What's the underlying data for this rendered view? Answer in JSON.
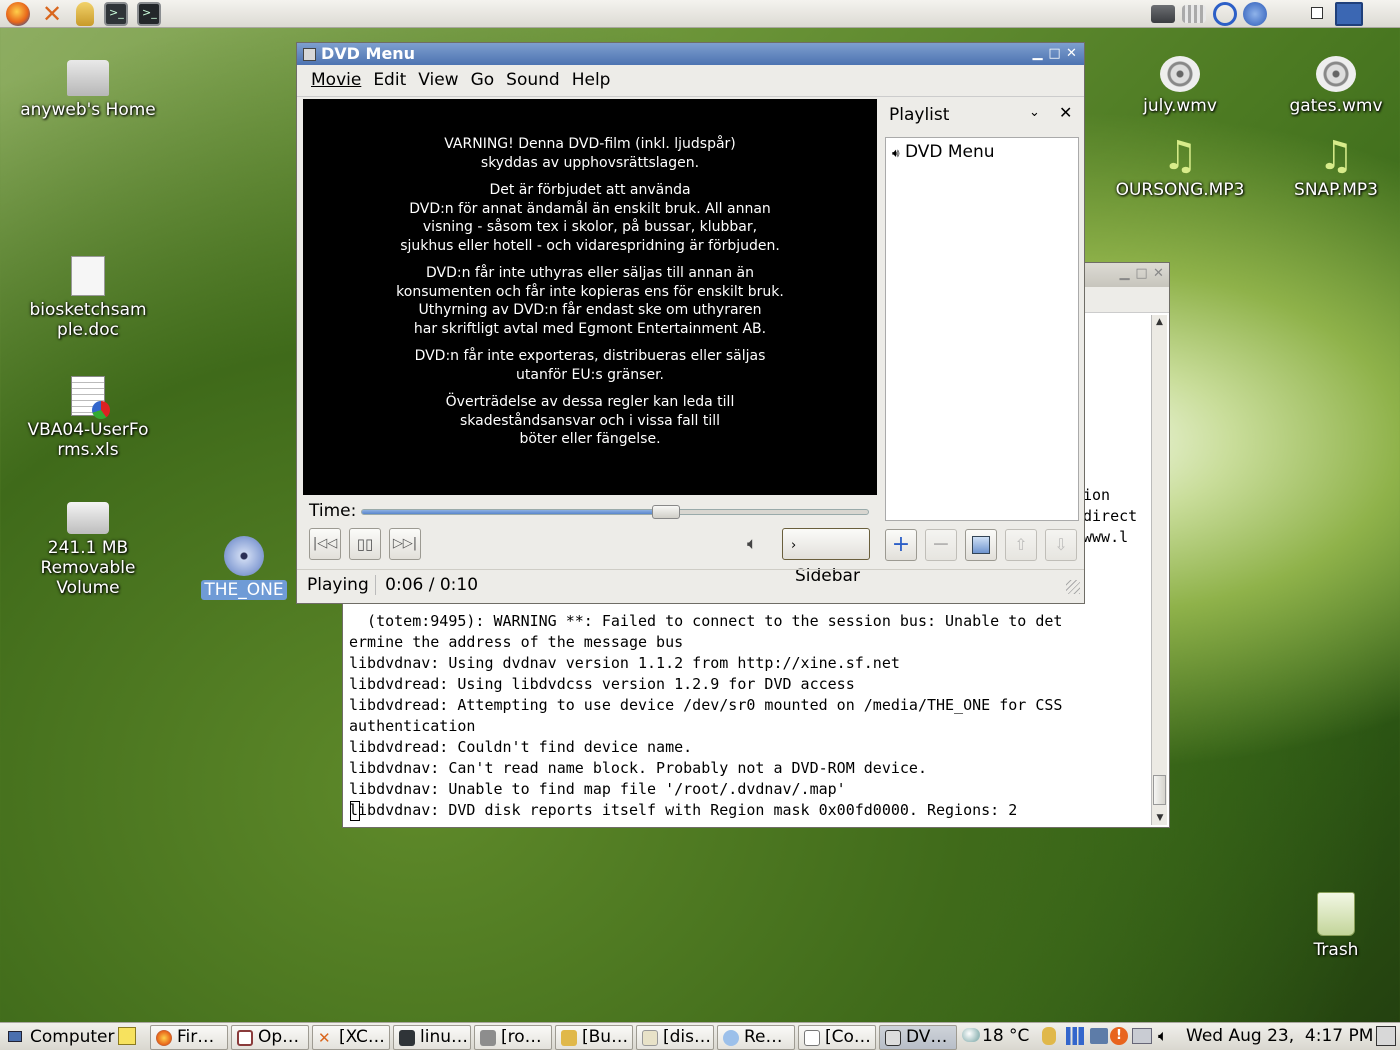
{
  "desktop": {
    "icons": [
      {
        "label": "anyweb's Home"
      },
      {
        "label": "biosketchsample.doc"
      },
      {
        "label": "VBA04-UserForms.xls"
      },
      {
        "label": "241.1 MB Removable Volume"
      },
      {
        "label": "THE_ONE"
      },
      {
        "label": "july.wmv"
      },
      {
        "label": "gates.wmv"
      },
      {
        "label": "OURSONG.MP3"
      },
      {
        "label": "SNAP.MP3"
      },
      {
        "label": "Trash"
      }
    ]
  },
  "terminal": {
    "partial_lines": [
      "ion",
      "direct",
      "www.l"
    ],
    "lines": [
      "  (totem:9495): WARNING **: Failed to connect to the session bus: Unable to det",
      "ermine the address of the message bus",
      "libdvdnav: Using dvdnav version 1.1.2 from http://xine.sf.net",
      "libdvdread: Using libdvdcss version 1.2.9 for DVD access",
      "libdvdread: Attempting to use device /dev/sr0 mounted on /media/THE_ONE for CSS",
      "authentication",
      "libdvdread: Couldn't find device name.",
      "libdvdnav: Can't read name block. Probably not a DVD-ROM device.",
      "libdvdnav: Unable to find map file '/root/.dvdnav/.map'",
      "libdvdnav: DVD disk reports itself with Region mask 0x00fd0000. Regions: 2"
    ]
  },
  "player": {
    "title": "DVD Menu",
    "menu": [
      "Movie",
      "Edit",
      "View",
      "Go",
      "Sound",
      "Help"
    ],
    "video_text": [
      "VARNING! Denna DVD-film (inkl. ljudspår)\nskyddas av upphovsrättslagen.",
      "Det är förbjudet att använda\nDVD:n för annat ändamål än enskilt bruk. All annan\nvisning - såsom tex i skolor, på bussar, klubbar,\nsjukhus eller hotell - och vidarespridning är förbjuden.",
      "DVD:n får inte uthyras eller säljas till annan än\nkonsumenten och får inte kopieras ens för enskilt bruk.\nUthyrning av DVD:n får endast ske om uthyraren\nhar skriftligt avtal med Egmont Entertainment AB.",
      "DVD:n får inte exporteras, distribueras eller säljas\nutanför EU:s gränser.",
      "Överträdelse av dessa regler kan leda till\nskadeståndsansvar och i vissa fall till\nböter eller fängelse."
    ],
    "time_label": "Time:",
    "seek_fraction": 0.6,
    "sidebar_button": "Sidebar",
    "status": "Playing",
    "time_display": "0:06 / 0:10",
    "playlist": {
      "title": "Playlist",
      "items": [
        "DVD Menu"
      ]
    }
  },
  "taskbar": {
    "menu": "Computer",
    "tasks": [
      "Fir…",
      "Op…",
      "[XC…",
      "linu…",
      "[ro…",
      "[Bu…",
      "[dis…",
      "Re…",
      "[Co…",
      "DV…"
    ],
    "weather": "18 °C",
    "clock": "Wed Aug 23,  4:17 PM"
  }
}
